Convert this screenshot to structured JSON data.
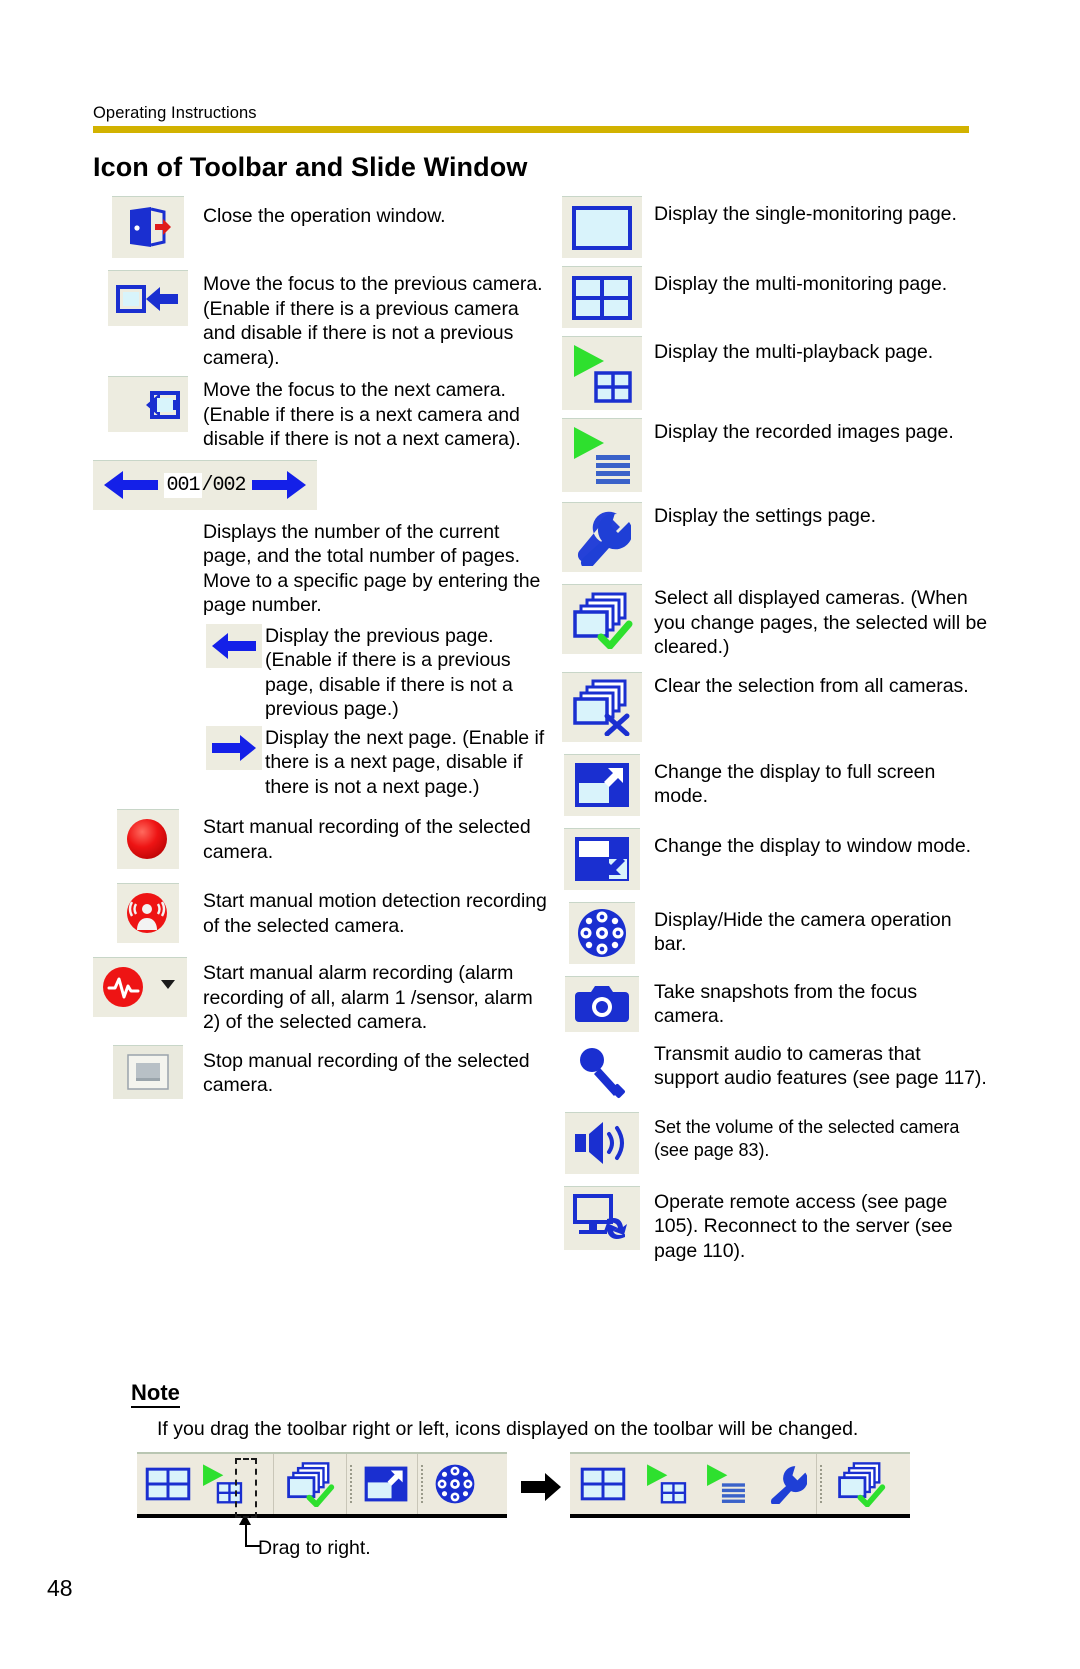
{
  "header": {
    "running_head": "Operating Instructions",
    "rule_color": "#d2b200",
    "title": "Icon of Toolbar and Slide Window"
  },
  "left_column": [
    {
      "icon": "close-window-icon",
      "text": "Close the operation window."
    },
    {
      "icon": "focus-previous-camera-icon",
      "text": "Move the focus to the previous camera. (Enable if there is a previous camera and disable if there is not a previous camera)."
    },
    {
      "icon": "focus-next-camera-icon",
      "text": "Move the focus to the next camera. (Enable if there is a next camera and disable if there is not a next camera)."
    },
    {
      "icon": "page-indicator-widget",
      "text": "Displays the number of the current page, and the total number of pages. Move to a specific page by entering the page number.",
      "current_page": "001",
      "total_pages": "/002"
    },
    {
      "icon": "previous-page-arrow-icon",
      "text": "Display the previous page. (Enable if there is a previous page, disable if there is not a previous page.)",
      "indented": true
    },
    {
      "icon": "next-page-arrow-icon",
      "text": "Display the next page. (Enable if there is a next page, disable if there is not a next page.)",
      "indented": true
    },
    {
      "icon": "manual-record-icon",
      "text": "Start manual recording of the selected camera."
    },
    {
      "icon": "motion-detection-record-icon",
      "text": "Start manual motion detection recording of the selected camera."
    },
    {
      "icon": "alarm-record-icon",
      "text": "Start manual alarm recording (alarm recording of all, alarm 1 /sensor, alarm 2) of the selected camera."
    },
    {
      "icon": "stop-record-icon",
      "text": "Stop manual recording of the selected camera."
    }
  ],
  "right_column": [
    {
      "icon": "single-monitoring-icon",
      "text": "Display the single-monitoring page."
    },
    {
      "icon": "multi-monitoring-icon",
      "text": "Display the multi-monitoring page."
    },
    {
      "icon": "multi-playback-icon",
      "text": "Display the multi-playback page."
    },
    {
      "icon": "recorded-images-icon",
      "text": "Display the recorded images page."
    },
    {
      "icon": "settings-wrench-icon",
      "text": "Display the settings page."
    },
    {
      "icon": "select-all-cameras-icon",
      "text": "Select all displayed cameras. (When you change pages, the selected will be cleared.)"
    },
    {
      "icon": "clear-selection-icon",
      "text": "Clear the selection from all cameras."
    },
    {
      "icon": "full-screen-icon",
      "text": "Change the display to full screen mode."
    },
    {
      "icon": "window-mode-icon",
      "text": "Change the display to window mode."
    },
    {
      "icon": "camera-operation-bar-icon",
      "text": "Display/Hide the camera operation bar."
    },
    {
      "icon": "snapshot-camera-icon",
      "text": "Take snapshots from the focus camera."
    },
    {
      "icon": "microphone-icon",
      "text": "Transmit audio to cameras that support audio features (see page 117)."
    },
    {
      "icon": "speaker-volume-icon",
      "text": "Set the volume of the selected camera (see page 83).",
      "small": true
    },
    {
      "icon": "remote-access-icon",
      "text": "Operate remote access (see page 105). Reconnect to the server (see page 110)."
    }
  ],
  "note": {
    "heading": "Note",
    "body": "If you drag the toolbar right or left, icons displayed on the toolbar will be changed."
  },
  "toolbar_figure": {
    "left_toolbar_icons": [
      "multi-monitoring-icon",
      "multi-playback-icon",
      "drag-handle",
      "select-all-cameras-icon",
      "full-screen-icon",
      "camera-operation-bar-icon"
    ],
    "right_toolbar_icons": [
      "multi-monitoring-icon",
      "multi-playback-icon",
      "recorded-images-icon",
      "settings-wrench-icon",
      "select-all-cameras-icon"
    ],
    "drag_caption": "Drag to right.",
    "transition_arrow": "right-arrow-icon"
  },
  "footer": {
    "page_number": "48"
  }
}
